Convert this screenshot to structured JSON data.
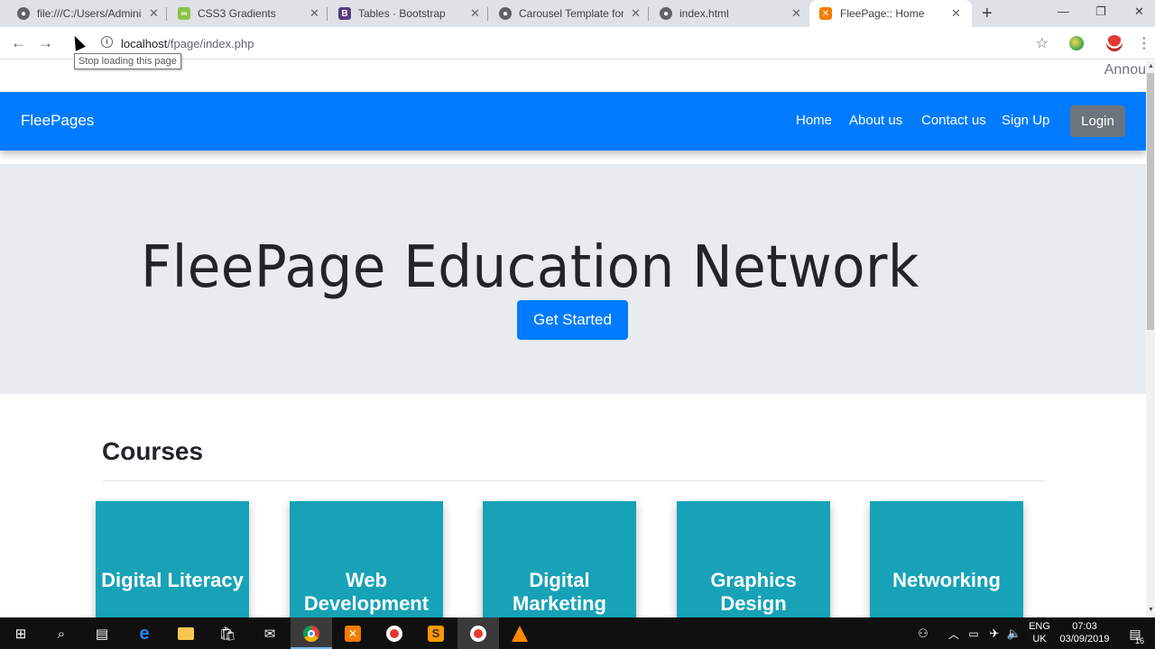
{
  "browser": {
    "tabs": [
      {
        "title": "file:///C:/Users/Adminis",
        "icon": "globe-icon",
        "color": "#5f6368"
      },
      {
        "title": "CSS3 Gradients",
        "icon": "css-gradient-icon",
        "color": "#8bc34a"
      },
      {
        "title": "Tables · Bootstrap",
        "icon": "bootstrap-icon",
        "color": "#563d7c"
      },
      {
        "title": "Carousel Template for B",
        "icon": "globe-icon",
        "color": "#5f6368"
      },
      {
        "title": "index.html",
        "icon": "globe-icon",
        "color": "#5f6368"
      },
      {
        "title": "FleePage:: Home",
        "icon": "xampp-icon",
        "color": "#f57c00"
      }
    ],
    "url_host": "localhost",
    "url_path": "/fpage/index.php",
    "tooltip": "Stop loading this page"
  },
  "page": {
    "marquee": "Annou",
    "brand": "FleePages",
    "nav": [
      "Home",
      "About us",
      "Contact us",
      "Sign Up"
    ],
    "login": "Login",
    "jumbotron_title": "FleePage Education Network",
    "get_started": "Get Started",
    "courses_heading": "Courses",
    "courses": [
      "Digital Literacy",
      "Web Development",
      "Digital Marketing",
      "Graphics Design",
      "Networking"
    ],
    "accent_color": "#007bff",
    "card_color": "#17a2b8"
  },
  "taskbar": {
    "lang_top": "ENG",
    "lang_bottom": "UK",
    "time": "07:03",
    "date": "03/09/2019",
    "notifications": "16"
  }
}
